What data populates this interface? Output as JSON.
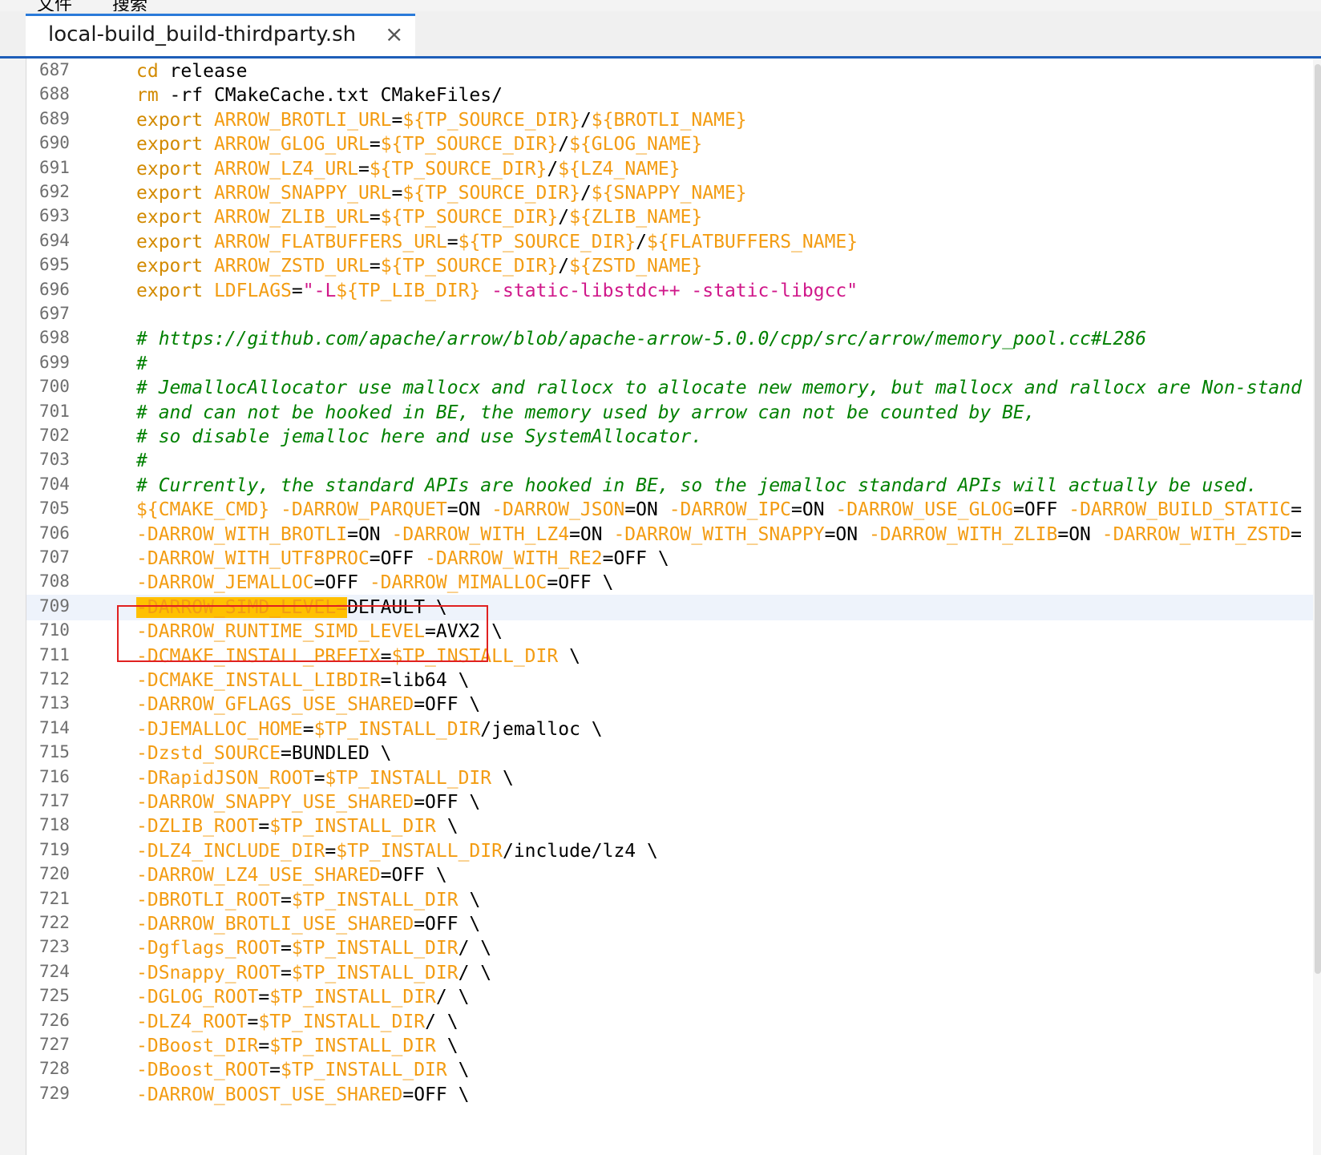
{
  "menubar": {
    "items": [
      "文件",
      "搜索"
    ]
  },
  "tab": {
    "title": "local-build_build-thirdparty.sh",
    "close": "×"
  },
  "annotation": {
    "color": "#e02020"
  },
  "highlight_color": "#ffc000",
  "lines": [
    {
      "n": "687",
      "segs": [
        {
          "c": "kw",
          "t": "cd"
        },
        {
          "t": " release"
        }
      ]
    },
    {
      "n": "688",
      "segs": [
        {
          "c": "kw",
          "t": "rm"
        },
        {
          "t": " -rf CMakeCache.txt CMakeFiles/"
        }
      ]
    },
    {
      "n": "689",
      "segs": [
        {
          "c": "kw",
          "t": "export"
        },
        {
          "t": " "
        },
        {
          "c": "var",
          "t": "ARROW_BROTLI_URL"
        },
        {
          "t": "="
        },
        {
          "c": "var",
          "t": "${TP_SOURCE_DIR}"
        },
        {
          "t": "/"
        },
        {
          "c": "var",
          "t": "${BROTLI_NAME}"
        }
      ]
    },
    {
      "n": "690",
      "segs": [
        {
          "c": "kw",
          "t": "export"
        },
        {
          "t": " "
        },
        {
          "c": "var",
          "t": "ARROW_GLOG_URL"
        },
        {
          "t": "="
        },
        {
          "c": "var",
          "t": "${TP_SOURCE_DIR}"
        },
        {
          "t": "/"
        },
        {
          "c": "var",
          "t": "${GLOG_NAME}"
        }
      ]
    },
    {
      "n": "691",
      "segs": [
        {
          "c": "kw",
          "t": "export"
        },
        {
          "t": " "
        },
        {
          "c": "var",
          "t": "ARROW_LZ4_URL"
        },
        {
          "t": "="
        },
        {
          "c": "var",
          "t": "${TP_SOURCE_DIR}"
        },
        {
          "t": "/"
        },
        {
          "c": "var",
          "t": "${LZ4_NAME}"
        }
      ]
    },
    {
      "n": "692",
      "segs": [
        {
          "c": "kw",
          "t": "export"
        },
        {
          "t": " "
        },
        {
          "c": "var",
          "t": "ARROW_SNAPPY_URL"
        },
        {
          "t": "="
        },
        {
          "c": "var",
          "t": "${TP_SOURCE_DIR}"
        },
        {
          "t": "/"
        },
        {
          "c": "var",
          "t": "${SNAPPY_NAME}"
        }
      ]
    },
    {
      "n": "693",
      "segs": [
        {
          "c": "kw",
          "t": "export"
        },
        {
          "t": " "
        },
        {
          "c": "var",
          "t": "ARROW_ZLIB_URL"
        },
        {
          "t": "="
        },
        {
          "c": "var",
          "t": "${TP_SOURCE_DIR}"
        },
        {
          "t": "/"
        },
        {
          "c": "var",
          "t": "${ZLIB_NAME}"
        }
      ]
    },
    {
      "n": "694",
      "segs": [
        {
          "c": "kw",
          "t": "export"
        },
        {
          "t": " "
        },
        {
          "c": "var",
          "t": "ARROW_FLATBUFFERS_URL"
        },
        {
          "t": "="
        },
        {
          "c": "var",
          "t": "${TP_SOURCE_DIR}"
        },
        {
          "t": "/"
        },
        {
          "c": "var",
          "t": "${FLATBUFFERS_NAME}"
        }
      ]
    },
    {
      "n": "695",
      "segs": [
        {
          "c": "kw",
          "t": "export"
        },
        {
          "t": " "
        },
        {
          "c": "var",
          "t": "ARROW_ZSTD_URL"
        },
        {
          "t": "="
        },
        {
          "c": "var",
          "t": "${TP_SOURCE_DIR}"
        },
        {
          "t": "/"
        },
        {
          "c": "var",
          "t": "${ZSTD_NAME}"
        }
      ]
    },
    {
      "n": "696",
      "segs": [
        {
          "c": "kw",
          "t": "export"
        },
        {
          "t": " "
        },
        {
          "c": "var",
          "t": "LDFLAGS"
        },
        {
          "t": "="
        },
        {
          "c": "str",
          "t": "\"-L"
        },
        {
          "c": "var",
          "t": "${TP_LIB_DIR}"
        },
        {
          "c": "str",
          "t": " -static-libstdc++ -static-libgcc\""
        }
      ]
    },
    {
      "n": "697",
      "segs": []
    },
    {
      "n": "698",
      "segs": [
        {
          "c": "cm",
          "t": "# https://github.com/apache/arrow/blob/apache-arrow-5.0.0/cpp/src/arrow/memory_pool.cc#L286"
        }
      ]
    },
    {
      "n": "699",
      "segs": [
        {
          "c": "cm",
          "t": "#"
        }
      ]
    },
    {
      "n": "700",
      "segs": [
        {
          "c": "cm",
          "t": "# JemallocAllocator use mallocx and rallocx to allocate new memory, but mallocx and rallocx are Non-stand"
        }
      ]
    },
    {
      "n": "701",
      "segs": [
        {
          "c": "cm",
          "t": "# and can not be hooked in BE, the memory used by arrow can not be counted by BE,"
        }
      ]
    },
    {
      "n": "702",
      "segs": [
        {
          "c": "cm",
          "t": "# so disable jemalloc here and use SystemAllocator."
        }
      ]
    },
    {
      "n": "703",
      "segs": [
        {
          "c": "cm",
          "t": "#"
        }
      ]
    },
    {
      "n": "704",
      "segs": [
        {
          "c": "cm",
          "t": "# Currently, the standard APIs are hooked in BE, so the jemalloc standard APIs will actually be used."
        }
      ]
    },
    {
      "n": "705",
      "segs": [
        {
          "c": "var",
          "t": "${CMAKE_CMD}"
        },
        {
          "t": " "
        },
        {
          "c": "var",
          "t": "-DARROW_PARQUET"
        },
        {
          "t": "=ON "
        },
        {
          "c": "var",
          "t": "-DARROW_JSON"
        },
        {
          "t": "=ON "
        },
        {
          "c": "var",
          "t": "-DARROW_IPC"
        },
        {
          "t": "=ON "
        },
        {
          "c": "var",
          "t": "-DARROW_USE_GLOG"
        },
        {
          "t": "=OFF "
        },
        {
          "c": "var",
          "t": "-DARROW_BUILD_STATIC"
        },
        {
          "t": "="
        }
      ]
    },
    {
      "n": "706",
      "segs": [
        {
          "c": "var",
          "t": "-DARROW_WITH_BROTLI"
        },
        {
          "t": "=ON "
        },
        {
          "c": "var",
          "t": "-DARROW_WITH_LZ4"
        },
        {
          "t": "=ON "
        },
        {
          "c": "var",
          "t": "-DARROW_WITH_SNAPPY"
        },
        {
          "t": "=ON "
        },
        {
          "c": "var",
          "t": "-DARROW_WITH_ZLIB"
        },
        {
          "t": "=ON "
        },
        {
          "c": "var",
          "t": "-DARROW_WITH_ZSTD"
        },
        {
          "t": "="
        }
      ]
    },
    {
      "n": "707",
      "segs": [
        {
          "c": "var",
          "t": "-DARROW_WITH_UTF8PROC"
        },
        {
          "t": "=OFF "
        },
        {
          "c": "var",
          "t": "-DARROW_WITH_RE2"
        },
        {
          "t": "=OFF \\"
        }
      ]
    },
    {
      "n": "708",
      "segs": [
        {
          "c": "var",
          "t": "-DARROW_JEMALLOC"
        },
        {
          "t": "=OFF "
        },
        {
          "c": "var",
          "t": "-DARROW_MIMALLOC"
        },
        {
          "t": "=OFF \\"
        }
      ]
    },
    {
      "n": "709",
      "current": true,
      "segs": [
        {
          "c": "var hl",
          "t": "-DARROW_SIMD_LEVEL="
        },
        {
          "t": "DEFAULT \\"
        }
      ]
    },
    {
      "n": "710",
      "segs": [
        {
          "c": "var",
          "t": "-DARROW_RUNTIME_SIMD_LEVEL"
        },
        {
          "t": "=AVX2 \\"
        }
      ]
    },
    {
      "n": "711",
      "segs": [
        {
          "c": "var",
          "t": "-DCMAKE_INSTALL_PREFIX"
        },
        {
          "t": "="
        },
        {
          "c": "var",
          "t": "$TP_INSTALL_DIR"
        },
        {
          "t": " \\"
        }
      ]
    },
    {
      "n": "712",
      "segs": [
        {
          "c": "var",
          "t": "-DCMAKE_INSTALL_LIBDIR"
        },
        {
          "t": "=lib64 \\"
        }
      ]
    },
    {
      "n": "713",
      "segs": [
        {
          "c": "var",
          "t": "-DARROW_GFLAGS_USE_SHARED"
        },
        {
          "t": "=OFF \\"
        }
      ]
    },
    {
      "n": "714",
      "segs": [
        {
          "c": "var",
          "t": "-DJEMALLOC_HOME"
        },
        {
          "t": "="
        },
        {
          "c": "var",
          "t": "$TP_INSTALL_DIR"
        },
        {
          "t": "/jemalloc \\"
        }
      ]
    },
    {
      "n": "715",
      "segs": [
        {
          "c": "var",
          "t": "-Dzstd_SOURCE"
        },
        {
          "t": "=BUNDLED \\"
        }
      ]
    },
    {
      "n": "716",
      "segs": [
        {
          "c": "var",
          "t": "-DRapidJSON_ROOT"
        },
        {
          "t": "="
        },
        {
          "c": "var",
          "t": "$TP_INSTALL_DIR"
        },
        {
          "t": " \\"
        }
      ]
    },
    {
      "n": "717",
      "segs": [
        {
          "c": "var",
          "t": "-DARROW_SNAPPY_USE_SHARED"
        },
        {
          "t": "=OFF \\"
        }
      ]
    },
    {
      "n": "718",
      "segs": [
        {
          "c": "var",
          "t": "-DZLIB_ROOT"
        },
        {
          "t": "="
        },
        {
          "c": "var",
          "t": "$TP_INSTALL_DIR"
        },
        {
          "t": " \\"
        }
      ]
    },
    {
      "n": "719",
      "segs": [
        {
          "c": "var",
          "t": "-DLZ4_INCLUDE_DIR"
        },
        {
          "t": "="
        },
        {
          "c": "var",
          "t": "$TP_INSTALL_DIR"
        },
        {
          "t": "/include/lz4 \\"
        }
      ]
    },
    {
      "n": "720",
      "segs": [
        {
          "c": "var",
          "t": "-DARROW_LZ4_USE_SHARED"
        },
        {
          "t": "=OFF \\"
        }
      ]
    },
    {
      "n": "721",
      "segs": [
        {
          "c": "var",
          "t": "-DBROTLI_ROOT"
        },
        {
          "t": "="
        },
        {
          "c": "var",
          "t": "$TP_INSTALL_DIR"
        },
        {
          "t": " \\"
        }
      ]
    },
    {
      "n": "722",
      "segs": [
        {
          "c": "var",
          "t": "-DARROW_BROTLI_USE_SHARED"
        },
        {
          "t": "=OFF \\"
        }
      ]
    },
    {
      "n": "723",
      "segs": [
        {
          "c": "var",
          "t": "-Dgflags_ROOT"
        },
        {
          "t": "="
        },
        {
          "c": "var",
          "t": "$TP_INSTALL_DIR"
        },
        {
          "t": "/ \\"
        }
      ]
    },
    {
      "n": "724",
      "segs": [
        {
          "c": "var",
          "t": "-DSnappy_ROOT"
        },
        {
          "t": "="
        },
        {
          "c": "var",
          "t": "$TP_INSTALL_DIR"
        },
        {
          "t": "/ \\"
        }
      ]
    },
    {
      "n": "725",
      "segs": [
        {
          "c": "var",
          "t": "-DGLOG_ROOT"
        },
        {
          "t": "="
        },
        {
          "c": "var",
          "t": "$TP_INSTALL_DIR"
        },
        {
          "t": "/ \\"
        }
      ]
    },
    {
      "n": "726",
      "segs": [
        {
          "c": "var",
          "t": "-DLZ4_ROOT"
        },
        {
          "t": "="
        },
        {
          "c": "var",
          "t": "$TP_INSTALL_DIR"
        },
        {
          "t": "/ \\"
        }
      ]
    },
    {
      "n": "727",
      "segs": [
        {
          "c": "var",
          "t": "-DBoost_DIR"
        },
        {
          "t": "="
        },
        {
          "c": "var",
          "t": "$TP_INSTALL_DIR"
        },
        {
          "t": " \\"
        }
      ]
    },
    {
      "n": "728",
      "segs": [
        {
          "c": "var",
          "t": "-DBoost_ROOT"
        },
        {
          "t": "="
        },
        {
          "c": "var",
          "t": "$TP_INSTALL_DIR"
        },
        {
          "t": " \\"
        }
      ]
    },
    {
      "n": "729",
      "segs": [
        {
          "c": "var",
          "t": "-DARROW_BOOST_USE_SHARED"
        },
        {
          "t": "=OFF \\"
        }
      ]
    }
  ]
}
